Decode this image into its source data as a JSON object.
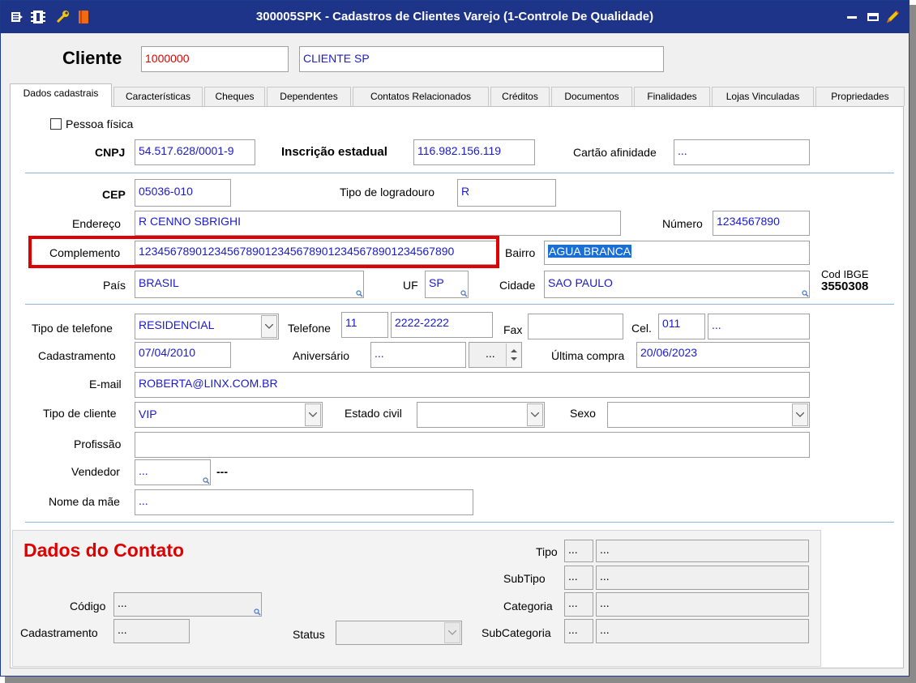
{
  "window": {
    "title": "300005SPK - Cadastros de Clientes Varejo (1-Controle De Qualidade)"
  },
  "client": {
    "label": "Cliente",
    "code": "1000000",
    "name": "CLIENTE SP"
  },
  "tabs": [
    "Dados cadastrais",
    "Características",
    "Cheques",
    "Dependentes",
    "Contatos Relacionados",
    "Créditos",
    "Documentos",
    "Finalidades",
    "Lojas Vinculadas",
    "Propriedades"
  ],
  "form": {
    "pessoa_fisica_label": "Pessoa física",
    "cnpj_label": "CNPJ",
    "cnpj": "54.517.628/0001-9",
    "ie_label": "Inscrição estadual",
    "ie": "116.982.156.119",
    "cartao_label": "Cartão afinidade",
    "cartao": "...",
    "cep_label": "CEP",
    "cep": "05036-010",
    "tipo_logradouro_label": "Tipo de logradouro",
    "tipo_logradouro": "R",
    "endereco_label": "Endereço",
    "endereco": "R CENNO SBRIGHI",
    "numero_label": "Número",
    "numero": "1234567890",
    "complemento_label": "Complemento",
    "complemento": "12345678901234567890123456789012345678901234567890",
    "bairro_label": "Bairro",
    "bairro": "AGUA BRANCA",
    "pais_label": "País",
    "pais": "BRASIL",
    "uf_label": "UF",
    "uf": "SP",
    "cidade_label": "Cidade",
    "cidade": "SAO PAULO",
    "cod_ibge_label": "Cod IBGE",
    "cod_ibge": "3550308",
    "tipo_telefone_label": "Tipo de telefone",
    "tipo_telefone": "RESIDENCIAL",
    "telefone_label": "Telefone",
    "ddd": "11",
    "telefone": "2222-2222",
    "fax_label": "Fax",
    "fax": "",
    "cel_label": "Cel.",
    "cel_ddd": "011",
    "cel": "...",
    "cadastramento_label": "Cadastramento",
    "cadastramento": "07/04/2010",
    "aniversario_label": "Aniversário",
    "aniversario": "...",
    "aniversario2": "...",
    "ultima_compra_label": "Última compra",
    "ultima_compra": "20/06/2023",
    "email_label": "E-mail",
    "email": "ROBERTA@LINX.COM.BR",
    "tipo_cliente_label": "Tipo de cliente",
    "tipo_cliente": "VIP",
    "estado_civil_label": "Estado civil",
    "estado_civil": "",
    "sexo_label": "Sexo",
    "sexo": "",
    "profissao_label": "Profissão",
    "profissao": "",
    "vendedor_label": "Vendedor",
    "vendedor": "...",
    "vendedor_name": "---",
    "nome_mae_label": "Nome da mãe",
    "nome_mae": "..."
  },
  "contato": {
    "heading": "Dados do Contato",
    "codigo_label": "Código",
    "codigo": "...",
    "cadastramento_label": "Cadastramento",
    "cadastramento": "...",
    "status_label": "Status",
    "status": "",
    "tipo_label": "Tipo",
    "subtipo_label": "SubTipo",
    "categoria_label": "Categoria",
    "subcategoria_label": "SubCategoria",
    "dots": "...",
    "dots_long": "..."
  },
  "icons": [
    "menu-icon",
    "tree-icon",
    "tools-icon",
    "book-icon",
    "minimize-icon",
    "restore-icon",
    "pencil-icon",
    "dropdown-arrow-icon",
    "lookup-magnifier-icon",
    "spin-icon"
  ],
  "colors": {
    "titlebar": "#1e3488",
    "field_text": "#1a1acc",
    "highlight": "#e00000",
    "heading": "#e00000"
  }
}
